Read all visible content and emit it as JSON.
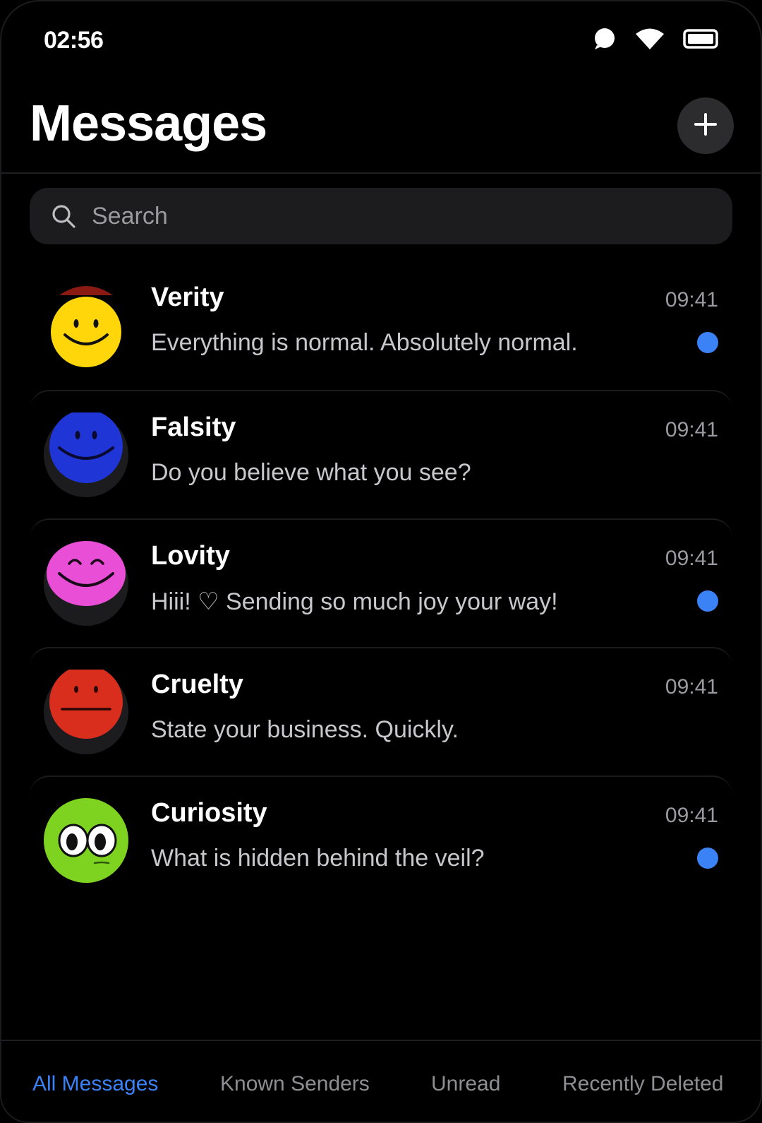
{
  "status_bar": {
    "time": "02:56",
    "icons": [
      "notification-icon",
      "wifi-icon",
      "battery-icon"
    ]
  },
  "header": {
    "title": "Messages",
    "compose_icon": "plus-icon"
  },
  "search": {
    "placeholder": "Search",
    "value": "",
    "icon": "search-icon"
  },
  "conversations": [
    {
      "name": "Verity",
      "time": "09:41",
      "preview": "Everything is normal. Absolutely normal.",
      "unread": true,
      "avatar": "yellow-smiley-icon"
    },
    {
      "name": "Falsity",
      "time": "09:41",
      "preview": "Do you believe what you see?",
      "unread": false,
      "avatar": "blue-smiley-icon"
    },
    {
      "name": "Lovity",
      "time": "09:41",
      "preview": "Hiii! ♡ Sending so much joy your way!",
      "unread": true,
      "avatar": "pink-smiley-icon"
    },
    {
      "name": "Cruelty",
      "time": "09:41",
      "preview": "State your business. Quickly.",
      "unread": false,
      "avatar": "red-neutral-face-icon"
    },
    {
      "name": "Curiosity",
      "time": "09:41",
      "preview": "What is hidden behind the veil?",
      "unread": true,
      "avatar": "green-curious-face-icon"
    }
  ],
  "tabs": [
    {
      "label": "All Messages",
      "active": true
    },
    {
      "label": "Known Senders",
      "active": false
    },
    {
      "label": "Unread",
      "active": false
    },
    {
      "label": "Recently Deleted",
      "active": false
    }
  ],
  "colors": {
    "background": "#000000",
    "accent": "#3b82f6",
    "search_bg": "#1c1c1e",
    "secondary_text": "#9a9aa0"
  }
}
